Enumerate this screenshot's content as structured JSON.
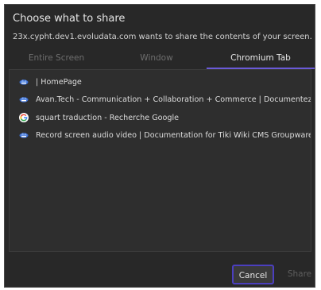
{
  "dialog": {
    "title": "Choose what to share",
    "subtitle": "23x.cypht.dev1.evoludata.com wants to share the contents of your screen."
  },
  "tabs": [
    {
      "label": "Entire Screen",
      "active": false
    },
    {
      "label": "Window",
      "active": false
    },
    {
      "label": "Chromium Tab",
      "active": true
    }
  ],
  "list": {
    "items": [
      {
        "icon": "tiki-wiki-favicon-icon",
        "label": "| HomePage"
      },
      {
        "icon": "tiki-wiki-favicon-icon",
        "label": "Avan.Tech - Communication + Collaboration + Commerce | Documentez la nouve"
      },
      {
        "icon": "google-favicon-icon",
        "label": "squart traduction - Recherche Google"
      },
      {
        "icon": "tiki-wiki-favicon-icon",
        "label": "Record screen audio video | Documentation for Tiki Wiki CMS Groupware"
      }
    ]
  },
  "buttons": {
    "cancel_label": "Cancel",
    "share_label": "Share"
  },
  "colors": {
    "dialog_bg": "#282828",
    "accent": "#6a5ad8",
    "button_focus_border": "#4b3fbf"
  }
}
